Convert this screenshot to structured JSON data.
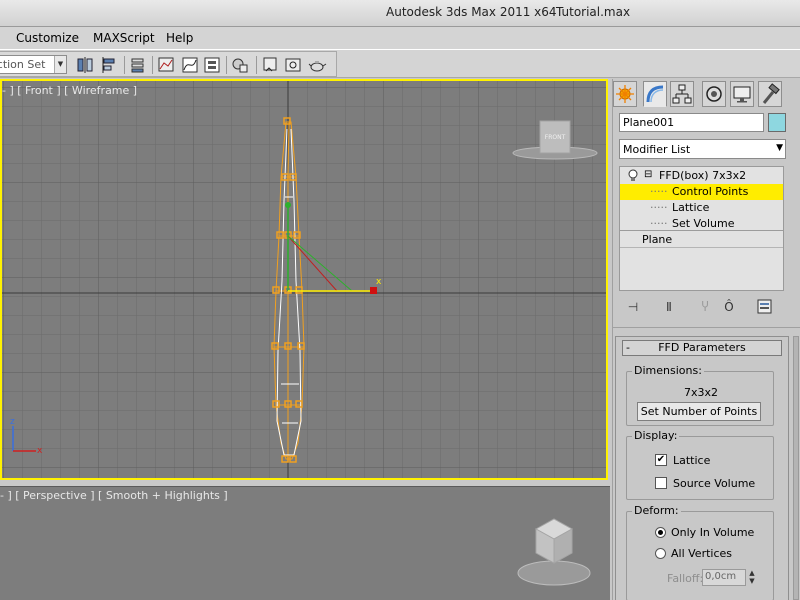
{
  "titlebar": {
    "app_title": "Autodesk 3ds Max  2011 x64",
    "file_name": "Tutorial.max"
  },
  "menu": {
    "items": [
      "Customize",
      "MAXScript",
      "Help"
    ]
  },
  "toolbar": {
    "selection_set_text": "ection Set"
  },
  "viewports": {
    "front": {
      "label": "- ] [ Front ] [ Wireframe ]",
      "viewcube_label": "FRONT",
      "gizmo_x_label": "x",
      "axis_z_label": "z",
      "axis_x_label": "x"
    },
    "perspective": {
      "label": "- ] [ Perspective ] [ Smooth + Highlights ]"
    }
  },
  "command_panel": {
    "tabs": [
      "create-icon",
      "modify-icon",
      "hierarchy-icon",
      "motion-icon",
      "display-icon",
      "utilities-icon"
    ],
    "object_name": "Plane001",
    "object_color": "#8ed7e0",
    "modifier_list_label": "Modifier List",
    "stack": {
      "modifier": "FFD(box) 7x3x2",
      "subobjects": [
        "Control Points",
        "Lattice",
        "Set Volume"
      ],
      "selected_subobject": "Control Points",
      "base_object": "Plane"
    },
    "rollout": {
      "title": "FFD Parameters",
      "collapse_symbol": "-",
      "dimensions_label": "Dimensions:",
      "dimensions_value": "7x3x2",
      "set_points_button": "Set Number of Points",
      "display_label": "Display:",
      "lattice_label": "Lattice",
      "lattice_checked": true,
      "source_volume_label": "Source Volume",
      "source_volume_checked": false,
      "deform_label": "Deform:",
      "only_in_volume_label": "Only In Volume",
      "all_vertices_label": "All Vertices",
      "deform_mode": "Only In Volume",
      "falloff_label": "Falloff:",
      "falloff_value": "0,0cm"
    }
  },
  "colors": {
    "viewport_bg": "#7d7d7d",
    "grid": "#6b6b6b",
    "active_border": "#fff200",
    "lattice": "#f0a020",
    "selection": "#ffed00"
  }
}
